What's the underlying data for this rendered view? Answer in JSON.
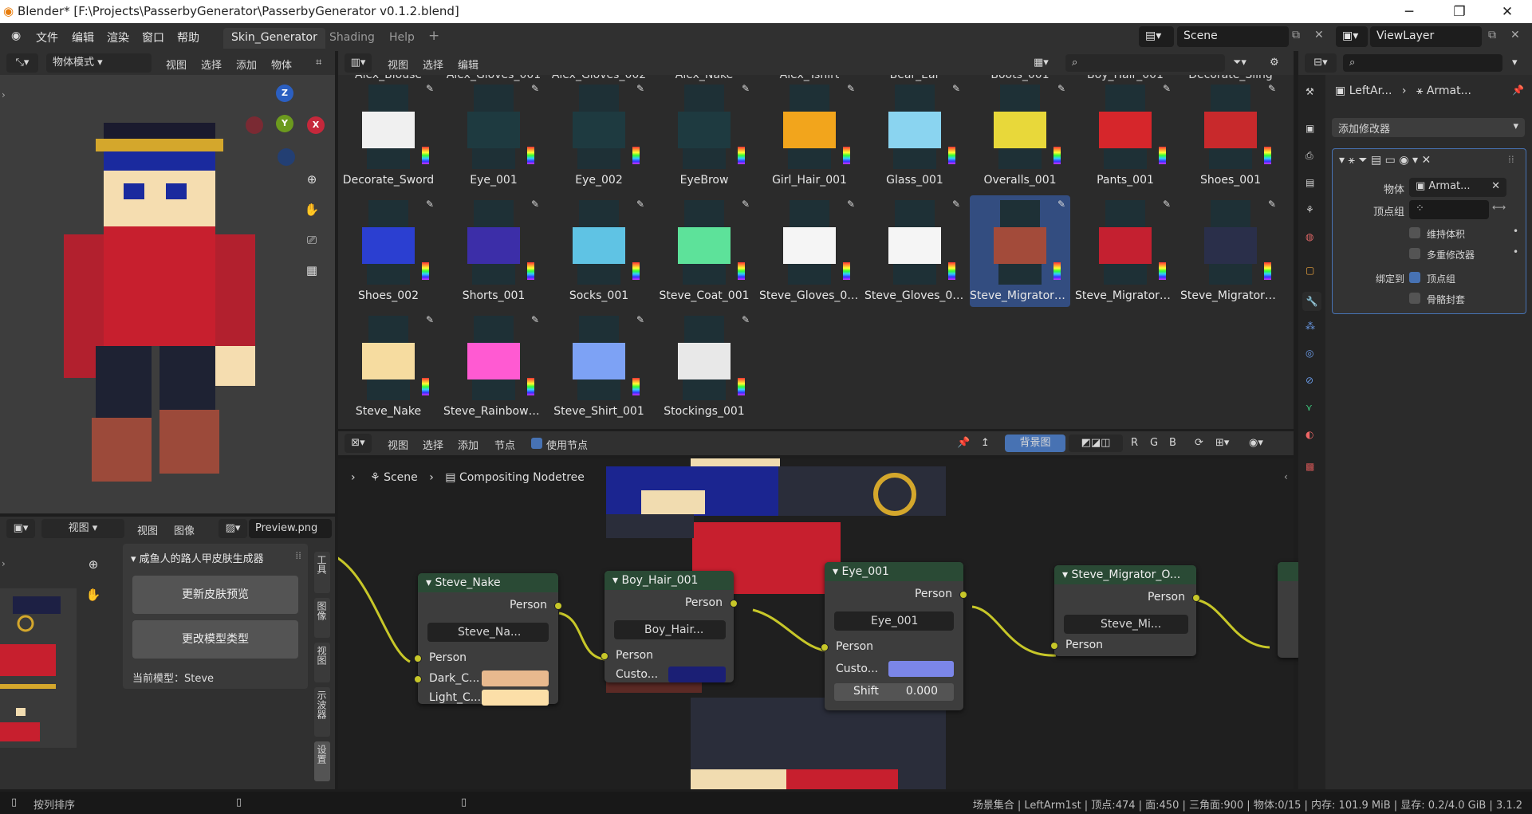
{
  "window": {
    "title": "Blender* [F:\\Projects\\PasserbyGenerator\\PasserbyGenerator v0.1.2.blend]",
    "minimize": "─",
    "maximize": "❐",
    "close": "✕"
  },
  "topbar": {
    "menus": [
      "文件",
      "编辑",
      "渲染",
      "窗口",
      "帮助"
    ],
    "tabs": [
      "Skin_Generator",
      "Shading",
      "Help"
    ],
    "add_tab": "+",
    "scene": "Scene",
    "view_layer": "ViewLayer"
  },
  "viewport": {
    "mode": "物体模式",
    "menus": [
      "视图",
      "选择",
      "添加",
      "物体"
    ],
    "axes": {
      "z": "Z",
      "y": "Y",
      "x": "X"
    }
  },
  "asset_browser": {
    "menus": [
      "视图",
      "选择",
      "编辑"
    ],
    "partial_row": [
      "Alex_Blouse",
      "Alex_Gloves_001",
      "Alex_Gloves_002",
      "Alex_Nake",
      "Alex_Tshirt",
      "Bear_Ear",
      "Boots_001",
      "Boy_Hair_001",
      "Decorate_Sling"
    ],
    "assets": [
      {
        "name": "Decorate_Sword",
        "color": "#f0f0f0"
      },
      {
        "name": "Eye_001",
        "color": "#1e3a40"
      },
      {
        "name": "Eye_002",
        "color": "#1e3a40"
      },
      {
        "name": "EyeBrow",
        "color": "#1e3a40"
      },
      {
        "name": "Girl_Hair_001",
        "color": "#f2a51c"
      },
      {
        "name": "Glass_001",
        "color": "#8ad4f0"
      },
      {
        "name": "Overalls_001",
        "color": "#e8d83a"
      },
      {
        "name": "Pants_001",
        "color": "#d6262b"
      },
      {
        "name": "Shoes_001",
        "color": "#c8292c"
      },
      {
        "name": "Shoes_002",
        "color": "#2b3fd1"
      },
      {
        "name": "Shorts_001",
        "color": "#3c2ea8"
      },
      {
        "name": "Socks_001",
        "color": "#5fc3e4"
      },
      {
        "name": "Steve_Coat_001",
        "color": "#5de29a"
      },
      {
        "name": "Steve_Gloves_001",
        "color": "#f5f5f5"
      },
      {
        "name": "Steve_Gloves_002",
        "color": "#f5f5f5"
      },
      {
        "name": "Steve_Migrator_O...",
        "color": "#a34b3a"
      },
      {
        "name": "Steve_Migrator_O...",
        "color": "#c42030"
      },
      {
        "name": "Steve_Migrator_O...",
        "color": "#2a2f4a"
      },
      {
        "name": "Steve_Nake",
        "color": "#f6dca0"
      },
      {
        "name": "Steve_Rainbow_C...",
        "color": "#ff5ad2"
      },
      {
        "name": "Steve_Shirt_001",
        "color": "#7da2f5"
      },
      {
        "name": "Stockings_001",
        "color": "#e8e8e8"
      }
    ],
    "selected_index": 15
  },
  "node_editor": {
    "menus": [
      "视图",
      "选择",
      "添加",
      "节点"
    ],
    "use_nodes": "使用节点",
    "backdrop": "背景图",
    "channels": [
      "R",
      "G",
      "B"
    ],
    "breadcrumb": [
      "Scene",
      "Compositing Nodetree"
    ],
    "nodes": [
      {
        "title": "Steve_Nake",
        "output": "Person",
        "group": "Steve_Na...",
        "input": "Person",
        "fields": [
          {
            "label": "Dark_C...",
            "color": "#e8b98e"
          },
          {
            "label": "Light_C...",
            "color": "#fcdfa8"
          }
        ]
      },
      {
        "title": "Boy_Hair_001",
        "output": "Person",
        "group": "Boy_Hair...",
        "input": "Person",
        "fields": [
          {
            "label": "Custo...",
            "color": "#1b1f75"
          }
        ]
      },
      {
        "title": "Eye_001",
        "output": "Person",
        "group": "Eye_001",
        "input": "Person",
        "fields": [
          {
            "label": "Custo...",
            "color": "#7b86e8"
          }
        ],
        "shift_label": "Shift",
        "shift_value": "0.000"
      },
      {
        "title": "Steve_Migrator_O...",
        "output": "Person",
        "group": "Steve_Mi...",
        "input": "Person"
      }
    ]
  },
  "image_editor": {
    "menus": [
      "视图",
      "视图",
      "图像"
    ],
    "image": "Preview.png",
    "panel_title": "咸鱼人的路人甲皮肤生成器",
    "buttons": [
      "更新皮肤预览",
      "更改模型类型"
    ],
    "current_model": "当前模型：Steve",
    "side_tabs": [
      "工具",
      "图像",
      "视图",
      "示波器",
      "设置"
    ]
  },
  "properties": {
    "breadcrumb": [
      "LeftAr...",
      "Armat..."
    ],
    "add_modifier": "添加修改器",
    "object_label": "物体",
    "object_value": "Armat...",
    "vertex_group_label": "顶点组",
    "preserve_volume": "维持体积",
    "multi_modifier": "多重修改器",
    "bind_to": "绑定到",
    "vertex_groups": "顶点组",
    "bone_envelopes": "骨骼封套"
  },
  "statusbar": {
    "left": "按列排序",
    "right": "场景集合 | LeftArm1st | 顶点:474 | 面:450 | 三角面:900 | 物体:0/15 | 内存: 101.9 MiB | 显存: 0.2/4.0 GiB | 3.1.2"
  }
}
